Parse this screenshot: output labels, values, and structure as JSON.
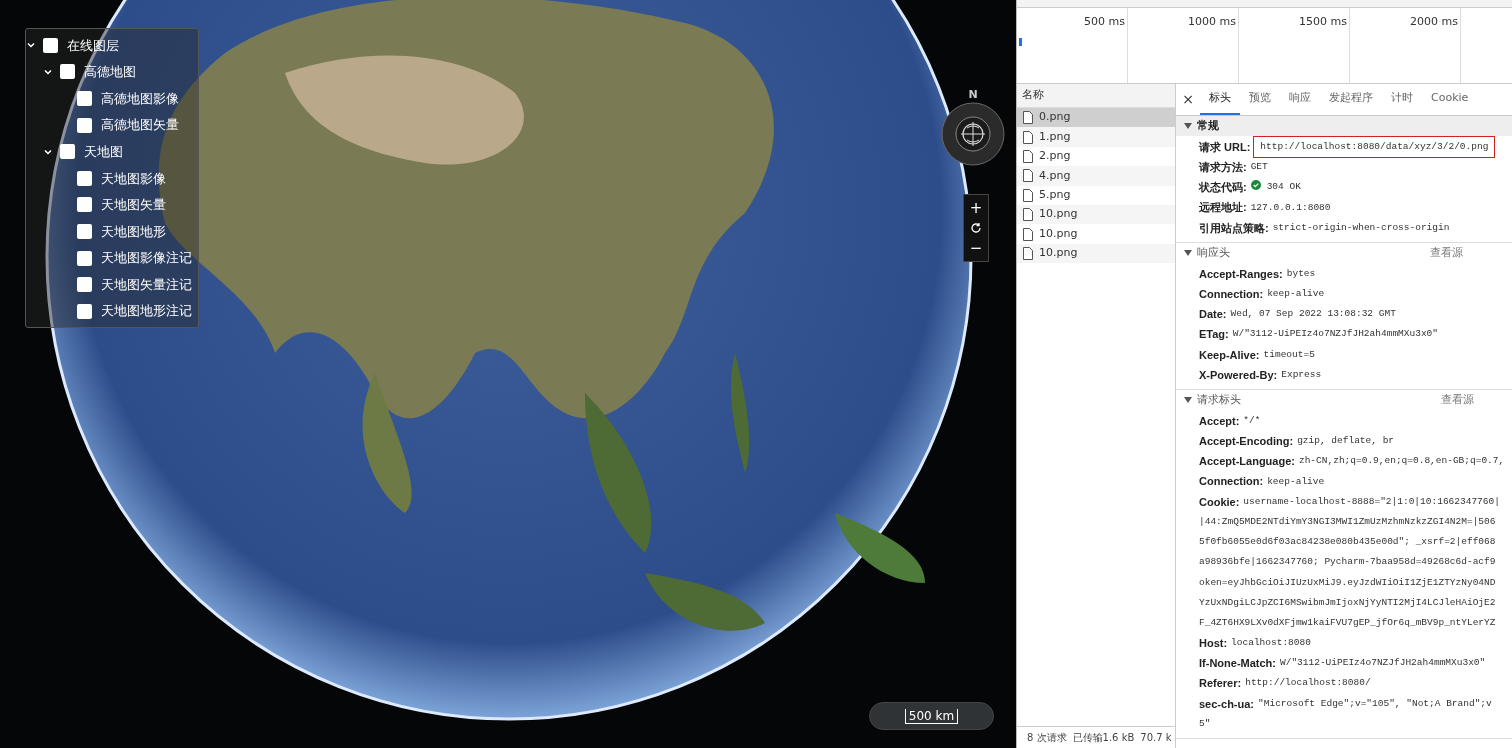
{
  "layer_tree": [
    {
      "label": "在线图层",
      "checked": false,
      "expanded": true,
      "children": [
        {
          "label": "高德地图",
          "checked": false,
          "expanded": true,
          "children": [
            {
              "label": "高德地图影像",
              "checked": false
            },
            {
              "label": "高德地图矢量",
              "checked": false
            }
          ]
        },
        {
          "label": "天地图",
          "checked": false,
          "expanded": true,
          "children": [
            {
              "label": "天地图影像",
              "checked": false
            },
            {
              "label": "天地图矢量",
              "checked": false
            },
            {
              "label": "天地图地形",
              "checked": false
            },
            {
              "label": "天地图影像注记",
              "checked": false
            },
            {
              "label": "天地图矢量注记",
              "checked": false
            },
            {
              "label": "天地图地形注记",
              "checked": false
            }
          ]
        }
      ]
    }
  ],
  "compass": {
    "label": "N"
  },
  "zoom_controls": [
    "+",
    "−"
  ],
  "scale_bar": {
    "label": "500 km"
  },
  "devtools": {
    "timeline": {
      "ticks": [
        "500 ms",
        "1000 ms",
        "1500 ms",
        "2000 ms"
      ]
    },
    "request_list": {
      "header": "名称",
      "items": [
        {
          "name": "0.png",
          "selected": true
        },
        {
          "name": "1.png",
          "selected": false
        },
        {
          "name": "2.png",
          "selected": false
        },
        {
          "name": "4.png",
          "selected": false
        },
        {
          "name": "5.png",
          "selected": false
        },
        {
          "name": "10.png",
          "selected": false
        },
        {
          "name": "10.png",
          "selected": false
        },
        {
          "name": "10.png",
          "selected": false
        }
      ]
    },
    "close": "×",
    "tabs": [
      {
        "label": "标头",
        "selected": true
      },
      {
        "label": "预览",
        "selected": false
      },
      {
        "label": "响应",
        "selected": false
      },
      {
        "label": "发起程序",
        "selected": false
      },
      {
        "label": "计时",
        "selected": false
      },
      {
        "label": "Cookie",
        "selected": false
      }
    ],
    "sections": [
      {
        "title": "常规",
        "expanded": true,
        "rows": [
          {
            "name": "请求 URL:",
            "value": "http://localhost:8080/data/xyz/3/2/0.png",
            "highlighted": true
          },
          {
            "name": "请求方法:",
            "value": "GET"
          },
          {
            "name": "状态代码:",
            "value": "304 OK",
            "status_ok": true
          },
          {
            "name": "远程地址:",
            "value": "127.0.0.1:8080"
          },
          {
            "name": "引用站点策略:",
            "value": "strict-origin-when-cross-origin"
          }
        ]
      },
      {
        "title": "响应头",
        "expanded": true,
        "action": "查看源",
        "rows": [
          {
            "name": "Accept-Ranges:",
            "value": "bytes"
          },
          {
            "name": "Connection:",
            "value": "keep-alive"
          },
          {
            "name": "Date:",
            "value": "Wed, 07 Sep 2022 13:08:32 GMT"
          },
          {
            "name": "ETag:",
            "value": "W/\"3112-UiPEIz4o7NZJfJH2ah4mmMXu3x0\""
          },
          {
            "name": "Keep-Alive:",
            "value": "timeout=5"
          },
          {
            "name": "X-Powered-By:",
            "value": "Express"
          }
        ]
      },
      {
        "title": "请求标头",
        "expanded": true,
        "action": "查看源",
        "rows": [
          {
            "name": "Accept:",
            "value": "*/*"
          },
          {
            "name": "Accept-Encoding:",
            "value": "gzip, deflate, br"
          },
          {
            "name": "Accept-Language:",
            "value": "zh-CN,zh;q=0.9,en;q=0.8,en-GB;q=0.7,"
          },
          {
            "name": "Connection:",
            "value": "keep-alive"
          },
          {
            "name": "Cookie:",
            "value": "username-localhost-8888=\"2|1:0|10:1662347760|",
            "more": [
              "|44:ZmQ5MDE2NTdiYmY3NGI3MWI1ZmUzMzhmNzkzZGI4N2M=|506",
              "5f0fb6055e0d6f03ac84238e080b435e00d\"; _xsrf=2|eff068",
              "a98936bfe|1662347760; Pycharm-7baa958d=49268c6d-acf9",
              "oken=eyJhbGciOiJIUzUxMiJ9.eyJzdWIiOiI1ZjE1ZTYzNy04ND",
              "YzUxNDgiLCJpZCI6MSwibmJmIjoxNjYyNTI2MjI4LCJleHAiOjE2",
              "F_4ZT6HX9LXv0dXFjmw1kaiFVU7gEP_jfOr6q_mBV9p_ntYLerYZ"
            ]
          },
          {
            "name": "Host:",
            "value": "localhost:8080"
          },
          {
            "name": "If-None-Match:",
            "value": "W/\"3112-UiPEIz4o7NZJfJH2ah4mmMXu3x0\""
          },
          {
            "name": "Referer:",
            "value": "http://localhost:8080/"
          },
          {
            "name": "sec-ch-ua:",
            "value": "\"Microsoft Edge\";v=\"105\", \"Not;A Brand\";v",
            "more": [
              "5\""
            ]
          }
        ]
      }
    ],
    "status_bar": [
      "8 次请求",
      "已传输1.6 kB",
      "70.7 k"
    ]
  }
}
